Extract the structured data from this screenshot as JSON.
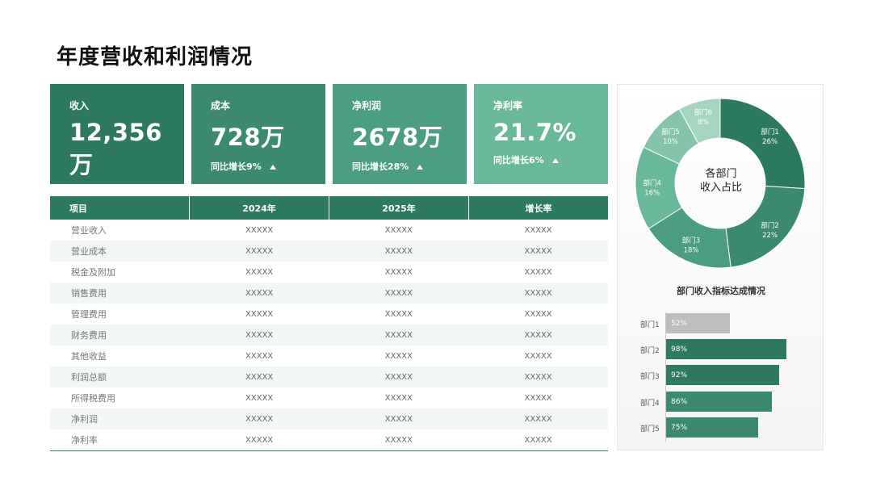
{
  "title": "年度营收和利润情况",
  "kpis": [
    {
      "label": "收入",
      "value": "12,356万",
      "growth": "同比增长9%",
      "color": "#2e7a60"
    },
    {
      "label": "成本",
      "value": "728万",
      "growth": "同比增长9%",
      "color": "#3b8a6d"
    },
    {
      "label": "净利润",
      "value": "2678万",
      "growth": "同比增长28%",
      "color": "#4b9e7f"
    },
    {
      "label": "净利率",
      "value": "21.7%",
      "growth": "同比增长6%",
      "color": "#6ab89a"
    }
  ],
  "table": {
    "headers": [
      "项目",
      "2024年",
      "2025年",
      "增长率"
    ],
    "rows": [
      [
        "营业收入",
        "XXXXX",
        "XXXXX",
        "XXXXX"
      ],
      [
        "营业成本",
        "XXXXX",
        "XXXXX",
        "XXXXX"
      ],
      [
        "税金及附加",
        "XXXXX",
        "XXXXX",
        "XXXXX"
      ],
      [
        "销售费用",
        "XXXXX",
        "XXXXX",
        "XXXXX"
      ],
      [
        "管理费用",
        "XXXXX",
        "XXXXX",
        "XXXXX"
      ],
      [
        "财务费用",
        "XXXXX",
        "XXXXX",
        "XXXXX"
      ],
      [
        "其他收益",
        "XXXXX",
        "XXXXX",
        "XXXXX"
      ],
      [
        "利润总额",
        "XXXXX",
        "XXXXX",
        "XXXXX"
      ],
      [
        "所得税费用",
        "XXXXX",
        "XXXXX",
        "XXXXX"
      ],
      [
        "净利润",
        "XXXXX",
        "XXXXX",
        "XXXXX"
      ],
      [
        "净利率",
        "XXXXX",
        "XXXXX",
        "XXXXX"
      ]
    ]
  },
  "chart_data": [
    {
      "type": "pie",
      "title": "各部门\n收入占比",
      "categories": [
        "部门1",
        "部门2",
        "部门3",
        "部门4",
        "部门5",
        "部门6"
      ],
      "values": [
        26,
        22,
        18,
        16,
        10,
        8
      ],
      "labels": [
        "26%",
        "22%",
        "18%",
        "16%",
        "10%",
        "8%"
      ],
      "colors": [
        "#2e7a60",
        "#3b8a6d",
        "#4b9e7f",
        "#6ab89a",
        "#85c4aa",
        "#a5d4c0"
      ]
    },
    {
      "type": "bar",
      "orientation": "horizontal",
      "title": "部门收入指标达成情况",
      "categories": [
        "部门1",
        "部门2",
        "部门3",
        "部门4",
        "部门5"
      ],
      "values": [
        52,
        98,
        92,
        86,
        75
      ],
      "labels": [
        "52%",
        "98%",
        "92%",
        "86%",
        "75%"
      ],
      "colors": [
        "#bdbdbd",
        "#2e7a60",
        "#2e7a60",
        "#3b8a6d",
        "#3b8a6d"
      ]
    }
  ]
}
